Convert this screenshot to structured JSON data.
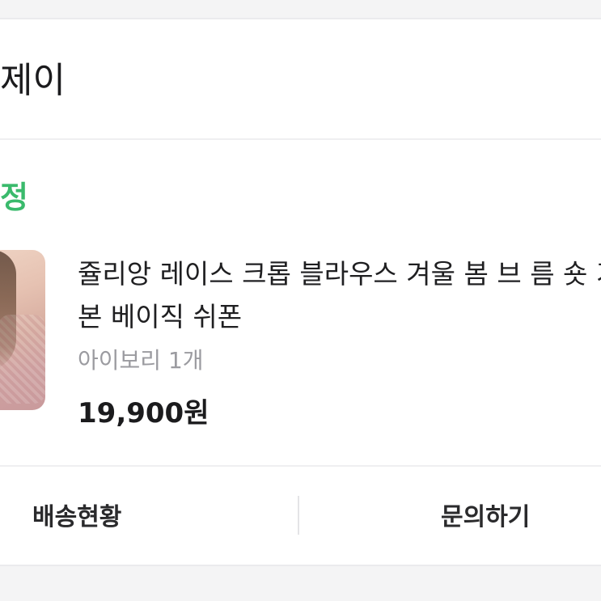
{
  "order": {
    "seller_name": "제이",
    "status": "정",
    "product": {
      "title": "쥴리앙 레이스 크롭 블라우스 겨울 봄 브 름 숏 기본 베이직 쉬폰",
      "option": "아이보리 1개",
      "price": "19,900원"
    },
    "actions": {
      "shipping_label": "배송현황",
      "inquiry_label": "문의하기"
    }
  },
  "colors": {
    "status": "#3aba6c",
    "background": "#f4f4f5",
    "card": "#ffffff"
  }
}
